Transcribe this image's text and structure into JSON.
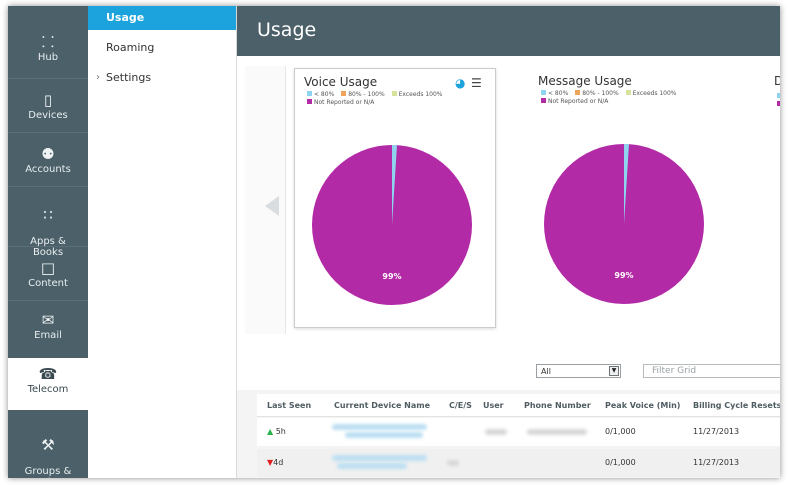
{
  "nav": {
    "items": [
      {
        "label": "Hub",
        "icon": "hub-icon",
        "glyph": "⸬",
        "active": false
      },
      {
        "label": "Devices",
        "icon": "device-icon",
        "glyph": "▯",
        "active": false
      },
      {
        "label": "Accounts",
        "icon": "accounts-icon",
        "glyph": "⚉",
        "active": false
      },
      {
        "label": "Apps &\nBooks",
        "icon": "apps-icon",
        "glyph": "∷",
        "active": false
      },
      {
        "label": "Content",
        "icon": "content-icon",
        "glyph": "□",
        "active": false
      },
      {
        "label": "Email",
        "icon": "email-icon",
        "glyph": "✉",
        "active": false
      },
      {
        "label": "Telecom",
        "icon": "telecom-icon",
        "glyph": "☎",
        "active": true
      },
      {
        "label": "Groups &\nSettings",
        "icon": "settings-icon",
        "glyph": "⚒",
        "active": false
      }
    ]
  },
  "submenu": {
    "items": [
      {
        "label": "Usage",
        "active": true
      },
      {
        "label": "Roaming",
        "active": false
      },
      {
        "label": "Settings",
        "active": false,
        "expandable": true
      }
    ]
  },
  "page": {
    "title": "Usage"
  },
  "colors": {
    "accent": "#1ca3dd",
    "header": "#4b6068",
    "pie_main": "#b32aa6",
    "pie_slice": "#8fd4ee",
    "lt80": "#8fd4ee",
    "80to100": "#f0a35c",
    "exceeds": "#d8e29a",
    "not_reported": "#b32aa6"
  },
  "cards": [
    {
      "title": "Voice Usage",
      "legend": [
        "< 80%",
        "80% - 100%",
        "Exceeds 100%",
        "Not Reported or N/A"
      ],
      "pie_label": "99%",
      "slices": [
        1,
        99
      ],
      "selected": true
    },
    {
      "title": "Message Usage",
      "legend": [
        "< 80%",
        "80% - 100%",
        "Exceeds 100%",
        "Not Reported or N/A"
      ],
      "pie_label": "99%",
      "slices": [
        1,
        99
      ],
      "selected": false
    },
    {
      "title": "D",
      "legend": [],
      "pie_label": "",
      "slices": [],
      "selected": false
    }
  ],
  "filters": {
    "select_value": "All",
    "filter_placeholder": "Filter Grid"
  },
  "table": {
    "columns": [
      "Last Seen",
      "Current Device Name",
      "C/E/S",
      "User",
      "Phone Number",
      "Peak Voice (Min)",
      "Billing Cycle Resets"
    ],
    "rows": [
      {
        "last_seen": "5h",
        "trend": "up",
        "peak_voice": "0/1,000",
        "billing_reset": "11/27/2013"
      },
      {
        "last_seen": "4d",
        "trend": "down",
        "peak_voice": "0/1,000",
        "billing_reset": "11/27/2013"
      }
    ]
  }
}
